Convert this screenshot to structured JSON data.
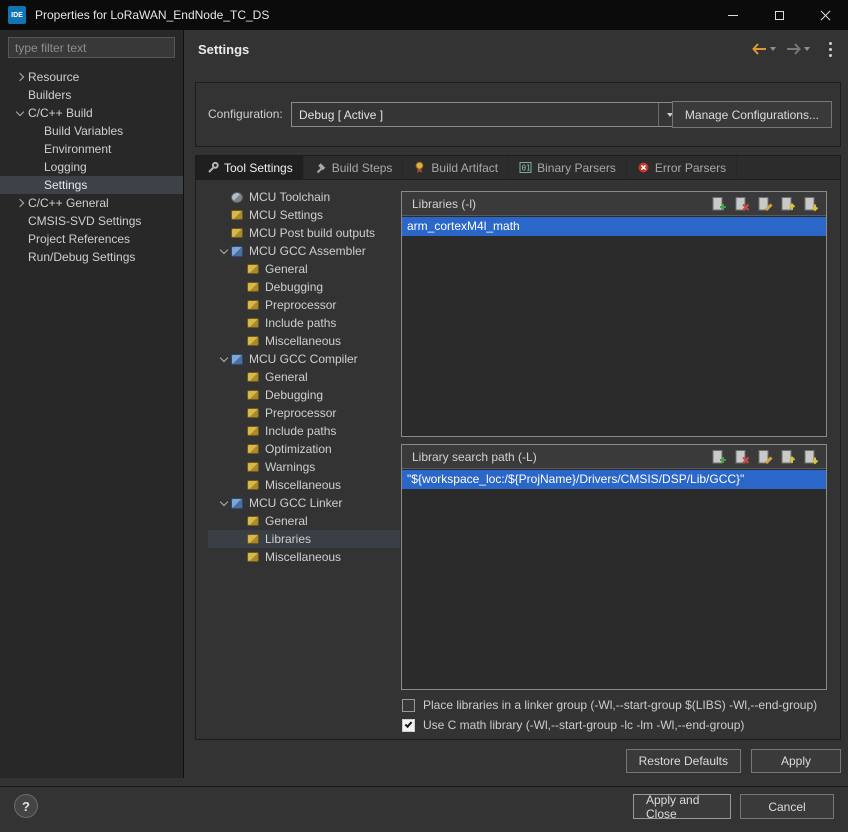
{
  "window": {
    "title": "Properties for LoRaWAN_EndNode_TC_DS",
    "app_icon": "IDE"
  },
  "sidebar": {
    "filter_placeholder": "type filter text",
    "items": [
      {
        "label": "Resource"
      },
      {
        "label": "Builders"
      },
      {
        "label": "C/C++ Build"
      },
      {
        "label": "Build Variables"
      },
      {
        "label": "Environment"
      },
      {
        "label": "Logging"
      },
      {
        "label": "Settings"
      },
      {
        "label": "C/C++ General"
      },
      {
        "label": "CMSIS-SVD Settings"
      },
      {
        "label": "Project References"
      },
      {
        "label": "Run/Debug Settings"
      }
    ]
  },
  "header": {
    "title": "Settings"
  },
  "configuration": {
    "label": "Configuration:",
    "selected": "Debug  [ Active ]",
    "manage_button": "Manage Configurations..."
  },
  "tabs": [
    {
      "label": "Tool Settings"
    },
    {
      "label": "Build Steps"
    },
    {
      "label": "Build Artifact"
    },
    {
      "label": "Binary Parsers"
    },
    {
      "label": "Error Parsers"
    }
  ],
  "tool_tree": {
    "items": [
      {
        "label": "MCU Toolchain"
      },
      {
        "label": "MCU Settings"
      },
      {
        "label": "MCU Post build outputs"
      },
      {
        "label": "MCU GCC Assembler"
      },
      {
        "label": "General"
      },
      {
        "label": "Debugging"
      },
      {
        "label": "Preprocessor"
      },
      {
        "label": "Include paths"
      },
      {
        "label": "Miscellaneous"
      },
      {
        "label": "MCU GCC Compiler"
      },
      {
        "label": "General"
      },
      {
        "label": "Debugging"
      },
      {
        "label": "Preprocessor"
      },
      {
        "label": "Include paths"
      },
      {
        "label": "Optimization"
      },
      {
        "label": "Warnings"
      },
      {
        "label": "Miscellaneous"
      },
      {
        "label": "MCU GCC Linker"
      },
      {
        "label": "General"
      },
      {
        "label": "Libraries"
      },
      {
        "label": "Miscellaneous"
      }
    ]
  },
  "libraries": {
    "title": "Libraries (-l)",
    "items": [
      "arm_cortexM4l_math"
    ],
    "toolbar_icons": [
      "add-item-icon",
      "delete-item-icon",
      "edit-item-icon",
      "move-up-icon",
      "move-down-icon"
    ]
  },
  "search_paths": {
    "title": "Library search path (-L)",
    "items": [
      "\"${workspace_loc:/${ProjName}/Drivers/CMSIS/DSP/Lib/GCC}\""
    ],
    "toolbar_icons": [
      "add-item-icon",
      "delete-item-icon",
      "edit-item-icon",
      "move-up-icon",
      "move-down-icon"
    ]
  },
  "options": {
    "linker_group": {
      "label": "Place libraries in a linker group (-Wl,--start-group $(LIBS) -Wl,--end-group)",
      "checked": false
    },
    "c_math": {
      "label": "Use C math library (-Wl,--start-group -lc -lm -Wl,--end-group)",
      "checked": true
    }
  },
  "panel_buttons": {
    "restore_defaults": "Restore Defaults",
    "apply": "Apply"
  },
  "dialog_buttons": {
    "help": "?",
    "apply_and_close": "Apply and Close",
    "cancel": "Cancel"
  },
  "colors": {
    "selection": "#2b66c9",
    "back_arrow_accent": "#dd9933",
    "titlebar": "#0b0b0b"
  }
}
